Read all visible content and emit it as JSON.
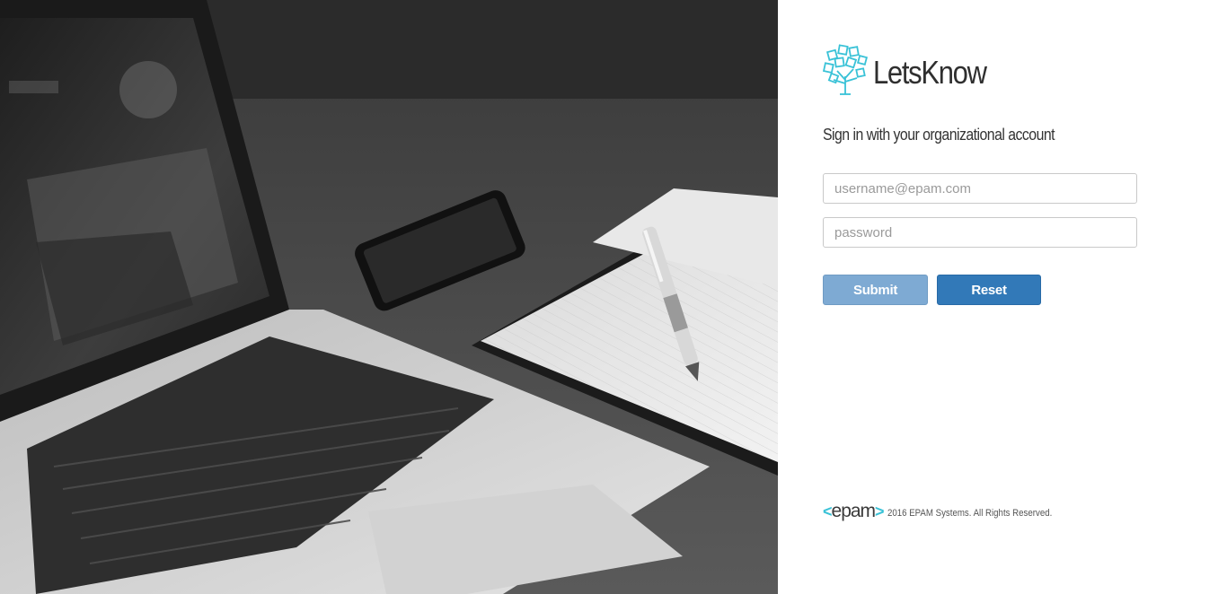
{
  "brand": {
    "name": "LetsKnow",
    "logo_icon": "tree-icon",
    "accent_color": "#39c2d7"
  },
  "login": {
    "subtitle": "Sign in with your organizational account",
    "username_placeholder": "username@epam.com",
    "password_placeholder": "password",
    "submit_label": "Submit",
    "reset_label": "Reset",
    "submit_color": "#7eaad3",
    "reset_color": "#3279b8"
  },
  "footer": {
    "epam_logo_text": "epam",
    "copyright": "2016 EPAM Systems. All Rights Reserved."
  },
  "hero": {
    "image": "grayscale photo of laptop, smartphone, notebook and pen on desk"
  }
}
